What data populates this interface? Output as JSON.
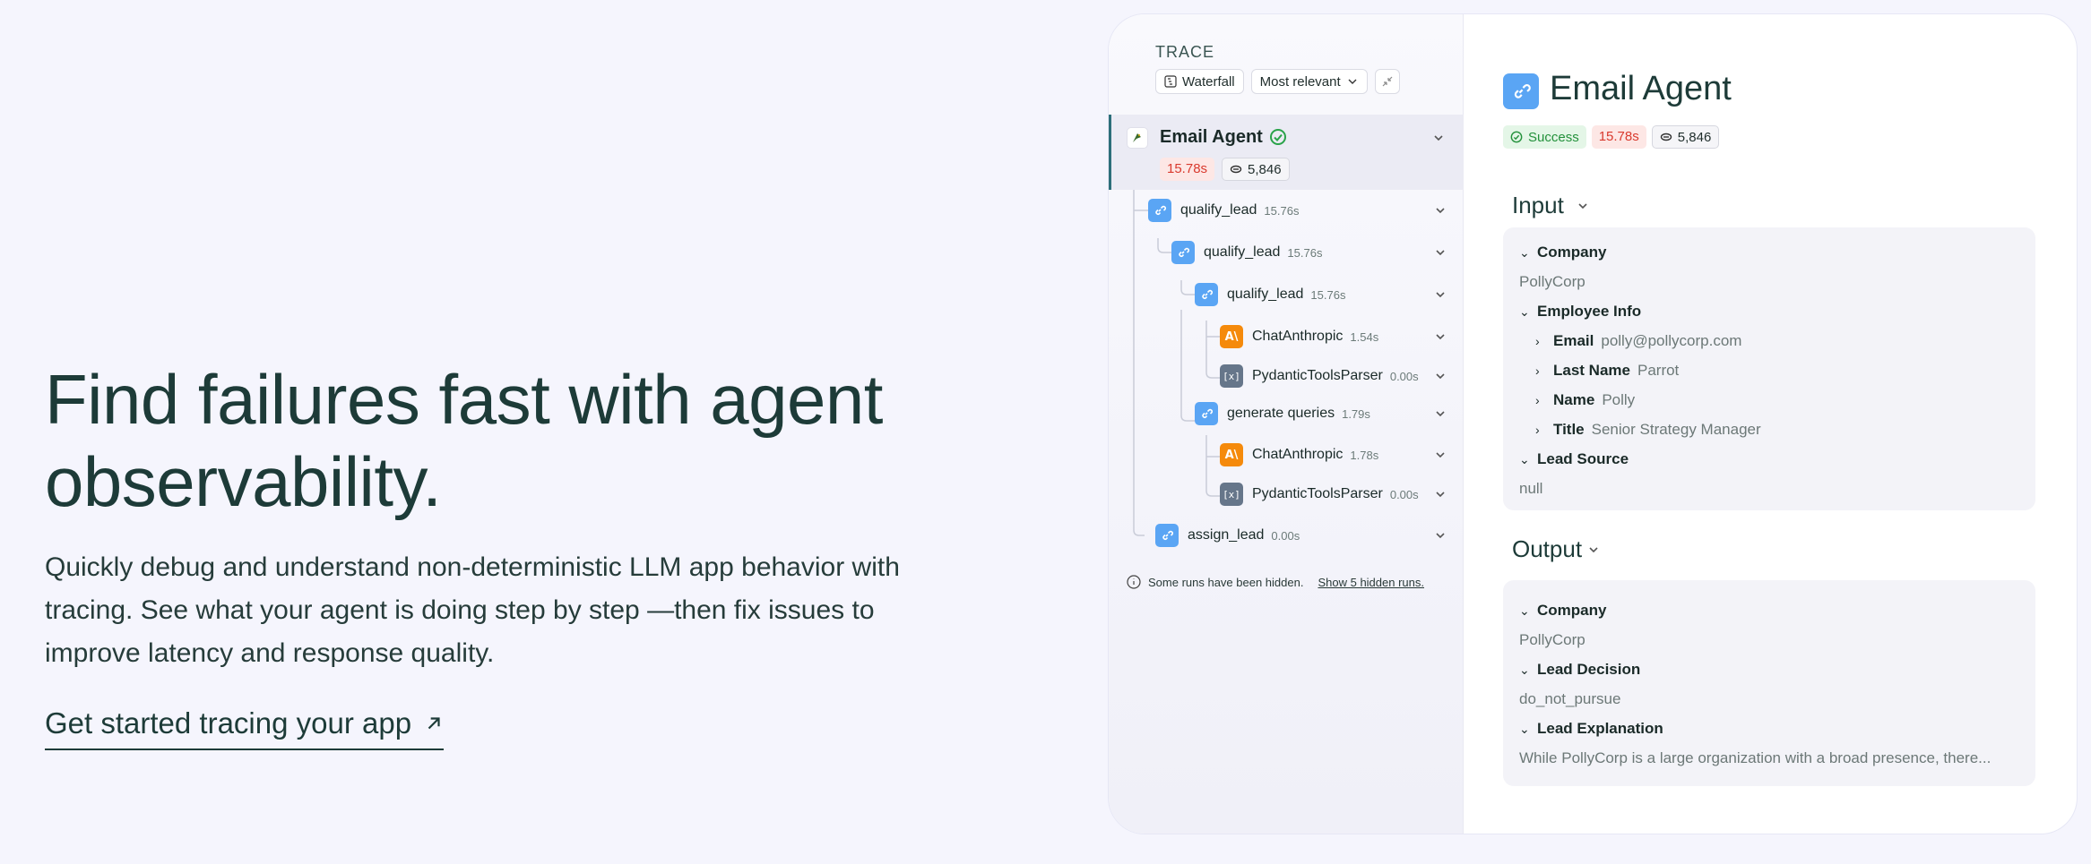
{
  "hero": {
    "title": "Find failures fast with agent observability.",
    "body": "Quickly debug and understand non-deterministic LLM app behavior with tracing. See what your agent is doing step by step —then fix issues to improve latency and response quality.",
    "cta": "Get started tracing your app"
  },
  "trace": {
    "label": "TRACE",
    "view_button": "Waterfall",
    "sort_button": "Most relevant",
    "root": {
      "name": "Email Agent",
      "latency": "15.78s",
      "tokens": "5,846"
    },
    "nodes": [
      {
        "name": "qualify_lead",
        "time": "15.76s",
        "icon": "chain-link-icon"
      },
      {
        "name": "qualify_lead",
        "time": "15.76s",
        "icon": "chain-link-icon"
      },
      {
        "name": "qualify_lead",
        "time": "15.76s",
        "icon": "chain-link-icon"
      },
      {
        "name": "ChatAnthropic",
        "time": "1.54s",
        "icon": "anthropic-icon"
      },
      {
        "name": "PydanticToolsParser",
        "time": "0.00s",
        "icon": "parser-icon"
      },
      {
        "name": "generate queries",
        "time": "1.79s",
        "icon": "chain-link-icon"
      },
      {
        "name": "ChatAnthropic",
        "time": "1.78s",
        "icon": "anthropic-icon"
      },
      {
        "name": "PydanticToolsParser",
        "time": "0.00s",
        "icon": "parser-icon"
      },
      {
        "name": "assign_lead",
        "time": "0.00s",
        "icon": "chain-link-icon"
      }
    ],
    "hidden_note": "Some runs have been hidden.",
    "hidden_link": "Show 5 hidden runs."
  },
  "detail": {
    "title": "Email Agent",
    "status": "Success",
    "latency": "15.78s",
    "tokens": "5,846",
    "input": {
      "label": "Input",
      "company_key": "Company",
      "company_val": "PollyCorp",
      "employee_key": "Employee Info",
      "email_key": "Email",
      "email_val": "polly@pollycorp.com",
      "last_name_key": "Last Name",
      "last_name_val": "Parrot",
      "name_key": "Name",
      "name_val": "Polly",
      "title_key": "Title",
      "title_val": "Senior Strategy Manager",
      "lead_source_key": "Lead Source",
      "lead_source_val": "null"
    },
    "output": {
      "label": "Output",
      "company_key": "Company",
      "company_val": "PollyCorp",
      "decision_key": "Lead Decision",
      "decision_val": "do_not_pursue",
      "explanation_key": "Lead Explanation",
      "explanation_val": "While PollyCorp is a large organization with a broad presence, there..."
    }
  },
  "colors": {
    "accent_teal": "#1d3b38",
    "chain_blue": "#5aa5f4",
    "llm_orange": "#f58a0b",
    "success_green": "#23913b",
    "latency_red": "#d93a2e"
  }
}
